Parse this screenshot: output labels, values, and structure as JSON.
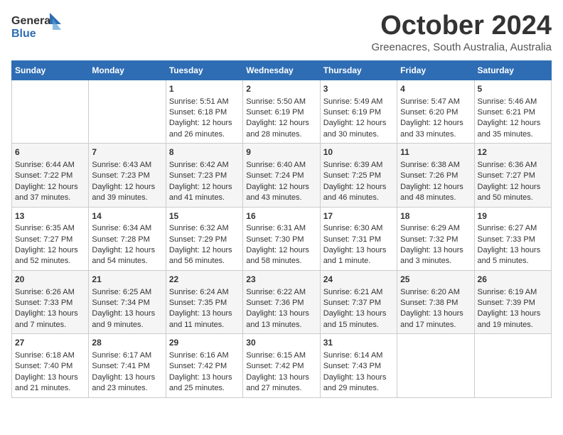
{
  "logo": {
    "line1": "General",
    "line2": "Blue"
  },
  "title": "October 2024",
  "location": "Greenacres, South Australia, Australia",
  "days_of_week": [
    "Sunday",
    "Monday",
    "Tuesday",
    "Wednesday",
    "Thursday",
    "Friday",
    "Saturday"
  ],
  "weeks": [
    [
      {
        "day": "",
        "sunrise": "",
        "sunset": "",
        "daylight": ""
      },
      {
        "day": "",
        "sunrise": "",
        "sunset": "",
        "daylight": ""
      },
      {
        "day": "1",
        "sunrise": "Sunrise: 5:51 AM",
        "sunset": "Sunset: 6:18 PM",
        "daylight": "Daylight: 12 hours and 26 minutes."
      },
      {
        "day": "2",
        "sunrise": "Sunrise: 5:50 AM",
        "sunset": "Sunset: 6:19 PM",
        "daylight": "Daylight: 12 hours and 28 minutes."
      },
      {
        "day": "3",
        "sunrise": "Sunrise: 5:49 AM",
        "sunset": "Sunset: 6:19 PM",
        "daylight": "Daylight: 12 hours and 30 minutes."
      },
      {
        "day": "4",
        "sunrise": "Sunrise: 5:47 AM",
        "sunset": "Sunset: 6:20 PM",
        "daylight": "Daylight: 12 hours and 33 minutes."
      },
      {
        "day": "5",
        "sunrise": "Sunrise: 5:46 AM",
        "sunset": "Sunset: 6:21 PM",
        "daylight": "Daylight: 12 hours and 35 minutes."
      }
    ],
    [
      {
        "day": "6",
        "sunrise": "Sunrise: 6:44 AM",
        "sunset": "Sunset: 7:22 PM",
        "daylight": "Daylight: 12 hours and 37 minutes."
      },
      {
        "day": "7",
        "sunrise": "Sunrise: 6:43 AM",
        "sunset": "Sunset: 7:23 PM",
        "daylight": "Daylight: 12 hours and 39 minutes."
      },
      {
        "day": "8",
        "sunrise": "Sunrise: 6:42 AM",
        "sunset": "Sunset: 7:23 PM",
        "daylight": "Daylight: 12 hours and 41 minutes."
      },
      {
        "day": "9",
        "sunrise": "Sunrise: 6:40 AM",
        "sunset": "Sunset: 7:24 PM",
        "daylight": "Daylight: 12 hours and 43 minutes."
      },
      {
        "day": "10",
        "sunrise": "Sunrise: 6:39 AM",
        "sunset": "Sunset: 7:25 PM",
        "daylight": "Daylight: 12 hours and 46 minutes."
      },
      {
        "day": "11",
        "sunrise": "Sunrise: 6:38 AM",
        "sunset": "Sunset: 7:26 PM",
        "daylight": "Daylight: 12 hours and 48 minutes."
      },
      {
        "day": "12",
        "sunrise": "Sunrise: 6:36 AM",
        "sunset": "Sunset: 7:27 PM",
        "daylight": "Daylight: 12 hours and 50 minutes."
      }
    ],
    [
      {
        "day": "13",
        "sunrise": "Sunrise: 6:35 AM",
        "sunset": "Sunset: 7:27 PM",
        "daylight": "Daylight: 12 hours and 52 minutes."
      },
      {
        "day": "14",
        "sunrise": "Sunrise: 6:34 AM",
        "sunset": "Sunset: 7:28 PM",
        "daylight": "Daylight: 12 hours and 54 minutes."
      },
      {
        "day": "15",
        "sunrise": "Sunrise: 6:32 AM",
        "sunset": "Sunset: 7:29 PM",
        "daylight": "Daylight: 12 hours and 56 minutes."
      },
      {
        "day": "16",
        "sunrise": "Sunrise: 6:31 AM",
        "sunset": "Sunset: 7:30 PM",
        "daylight": "Daylight: 12 hours and 58 minutes."
      },
      {
        "day": "17",
        "sunrise": "Sunrise: 6:30 AM",
        "sunset": "Sunset: 7:31 PM",
        "daylight": "Daylight: 13 hours and 1 minute."
      },
      {
        "day": "18",
        "sunrise": "Sunrise: 6:29 AM",
        "sunset": "Sunset: 7:32 PM",
        "daylight": "Daylight: 13 hours and 3 minutes."
      },
      {
        "day": "19",
        "sunrise": "Sunrise: 6:27 AM",
        "sunset": "Sunset: 7:33 PM",
        "daylight": "Daylight: 13 hours and 5 minutes."
      }
    ],
    [
      {
        "day": "20",
        "sunrise": "Sunrise: 6:26 AM",
        "sunset": "Sunset: 7:33 PM",
        "daylight": "Daylight: 13 hours and 7 minutes."
      },
      {
        "day": "21",
        "sunrise": "Sunrise: 6:25 AM",
        "sunset": "Sunset: 7:34 PM",
        "daylight": "Daylight: 13 hours and 9 minutes."
      },
      {
        "day": "22",
        "sunrise": "Sunrise: 6:24 AM",
        "sunset": "Sunset: 7:35 PM",
        "daylight": "Daylight: 13 hours and 11 minutes."
      },
      {
        "day": "23",
        "sunrise": "Sunrise: 6:22 AM",
        "sunset": "Sunset: 7:36 PM",
        "daylight": "Daylight: 13 hours and 13 minutes."
      },
      {
        "day": "24",
        "sunrise": "Sunrise: 6:21 AM",
        "sunset": "Sunset: 7:37 PM",
        "daylight": "Daylight: 13 hours and 15 minutes."
      },
      {
        "day": "25",
        "sunrise": "Sunrise: 6:20 AM",
        "sunset": "Sunset: 7:38 PM",
        "daylight": "Daylight: 13 hours and 17 minutes."
      },
      {
        "day": "26",
        "sunrise": "Sunrise: 6:19 AM",
        "sunset": "Sunset: 7:39 PM",
        "daylight": "Daylight: 13 hours and 19 minutes."
      }
    ],
    [
      {
        "day": "27",
        "sunrise": "Sunrise: 6:18 AM",
        "sunset": "Sunset: 7:40 PM",
        "daylight": "Daylight: 13 hours and 21 minutes."
      },
      {
        "day": "28",
        "sunrise": "Sunrise: 6:17 AM",
        "sunset": "Sunset: 7:41 PM",
        "daylight": "Daylight: 13 hours and 23 minutes."
      },
      {
        "day": "29",
        "sunrise": "Sunrise: 6:16 AM",
        "sunset": "Sunset: 7:42 PM",
        "daylight": "Daylight: 13 hours and 25 minutes."
      },
      {
        "day": "30",
        "sunrise": "Sunrise: 6:15 AM",
        "sunset": "Sunset: 7:42 PM",
        "daylight": "Daylight: 13 hours and 27 minutes."
      },
      {
        "day": "31",
        "sunrise": "Sunrise: 6:14 AM",
        "sunset": "Sunset: 7:43 PM",
        "daylight": "Daylight: 13 hours and 29 minutes."
      },
      {
        "day": "",
        "sunrise": "",
        "sunset": "",
        "daylight": ""
      },
      {
        "day": "",
        "sunrise": "",
        "sunset": "",
        "daylight": ""
      }
    ]
  ]
}
